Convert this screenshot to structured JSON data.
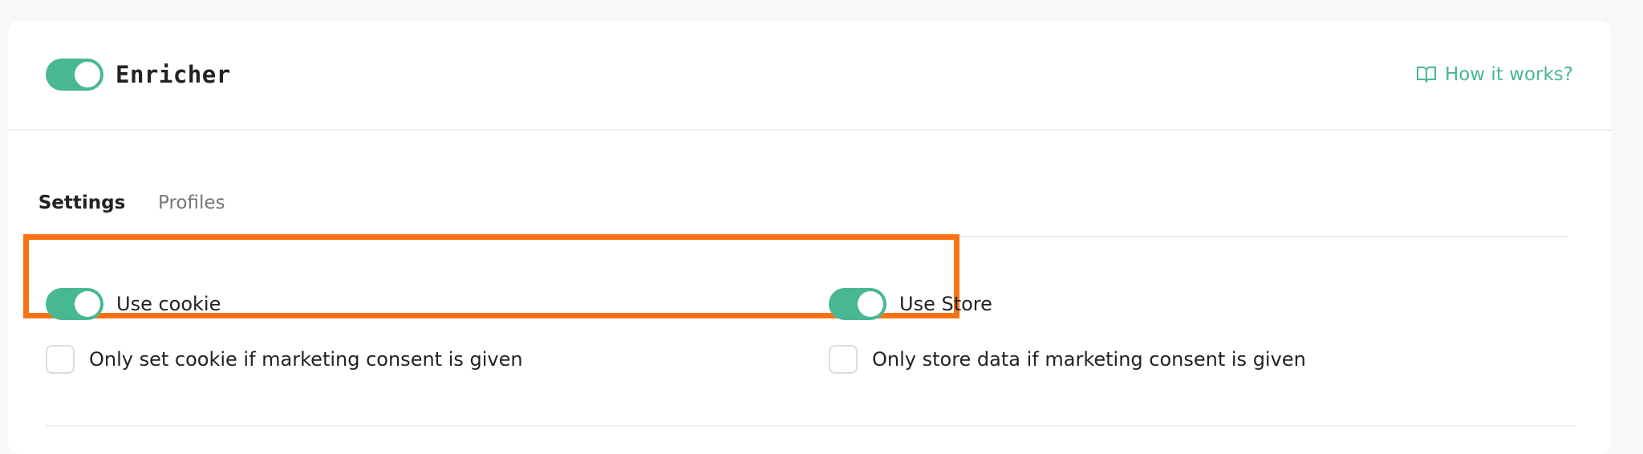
{
  "header": {
    "title": "Enricher",
    "enabled": true,
    "help_link_label": "How it works?"
  },
  "tabs": [
    {
      "label": "Settings",
      "active": true
    },
    {
      "label": "Profiles",
      "active": false
    }
  ],
  "settings": {
    "use_cookie": {
      "label": "Use cookie",
      "enabled": true
    },
    "use_store": {
      "label": "Use Store",
      "enabled": true
    },
    "cookie_consent": {
      "label": "Only set cookie if marketing consent is given",
      "checked": false
    },
    "store_consent": {
      "label": "Only store data if marketing consent is given",
      "checked": false
    }
  },
  "colors": {
    "accent": "#48b892",
    "highlight": "#f97316",
    "background": "#f8f8f8"
  },
  "icons": {
    "help": "book-open-icon"
  }
}
